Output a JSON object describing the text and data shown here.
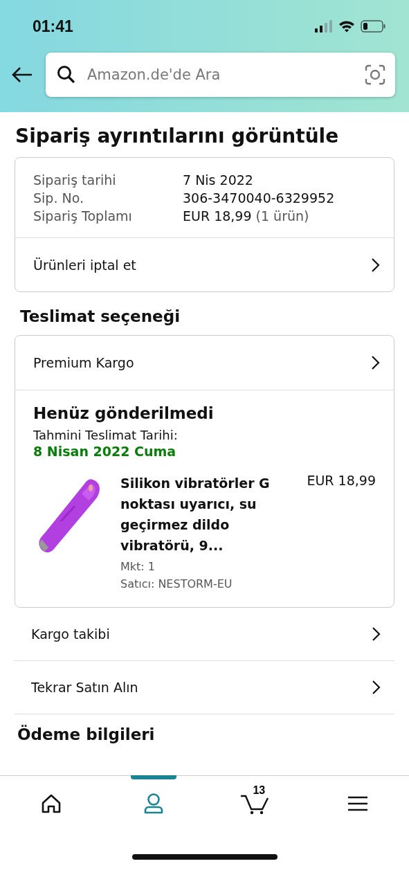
{
  "status_bar": {
    "time": "01:41"
  },
  "search": {
    "placeholder": "Amazon.de'de Ara"
  },
  "page_title": "Sipariş ayrıntılarını görüntüle",
  "order_summary": {
    "rows": [
      {
        "label": "Sipariş tarihi",
        "value": "7 Nis 2022"
      },
      {
        "label": "Sip. No.",
        "value": "306-3470040-6329952"
      },
      {
        "label": "Sipariş Toplamı",
        "value": "EUR 18,99",
        "note": "(1 ürün)"
      }
    ],
    "action": "Ürünleri iptal et"
  },
  "delivery_heading": "Teslimat seçeneği",
  "delivery": {
    "option": "Premium Kargo",
    "status": "Henüz gönderilmedi",
    "estimate_label": "Tahmini Teslimat Tarihi:",
    "estimate_date": "8 Nisan 2022 Cuma",
    "item": {
      "kind": "picture",
      "title": "Silikon vibratörler G noktası uyarıcı, su geçirmez dildo vibratörü, 9...",
      "price": "EUR 18,99",
      "quantity": "Mkt: 1",
      "seller": "Satıcı: NESTORM-EU"
    }
  },
  "links": [
    "Kargo takibi",
    "Tekrar Satın Alın"
  ],
  "next_heading": "Ödeme bilgileri",
  "tab_bar": [
    {
      "kind": "home",
      "selected": false
    },
    {
      "kind": "account",
      "selected": true
    },
    {
      "kind": "cart",
      "selected": false,
      "count": "13"
    },
    {
      "kind": "menu",
      "selected": false
    }
  ]
}
